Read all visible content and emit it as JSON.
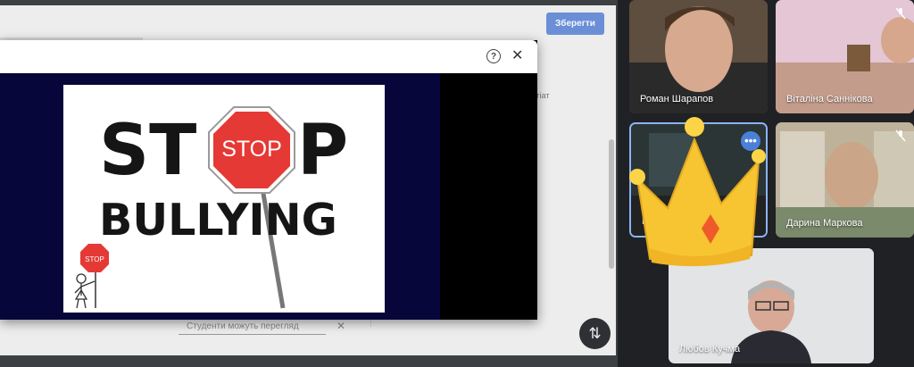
{
  "classroom": {
    "save_label": "Зберегти",
    "plagiat_label": "лагіат",
    "students_note": "Студенти можуть перегляд",
    "students_x": "✕"
  },
  "modal": {
    "help_icon": "?",
    "close_icon": "✕"
  },
  "poster": {
    "stop_word_left": "ST",
    "stop_sign_text": "STOP",
    "stop_word_right": "P",
    "bullying_text": "BULLYING",
    "small_sign_text": "STOP"
  },
  "fab_icon": "⇅",
  "participants": [
    {
      "name": "Роман Шарапов",
      "muted": false
    },
    {
      "name": "Віталіна Саннікова",
      "muted": true
    },
    {
      "name": "М",
      "muted": false
    },
    {
      "name": "Дарина Маркова",
      "muted": true
    },
    {
      "name": "Любов Кучма",
      "muted": false
    }
  ],
  "more_icon": "•••",
  "colors": {
    "stop_red": "#e53935",
    "save_blue": "#6b8fd6",
    "active_border": "#8ab4f8",
    "crown_gold": "#f7c531"
  }
}
